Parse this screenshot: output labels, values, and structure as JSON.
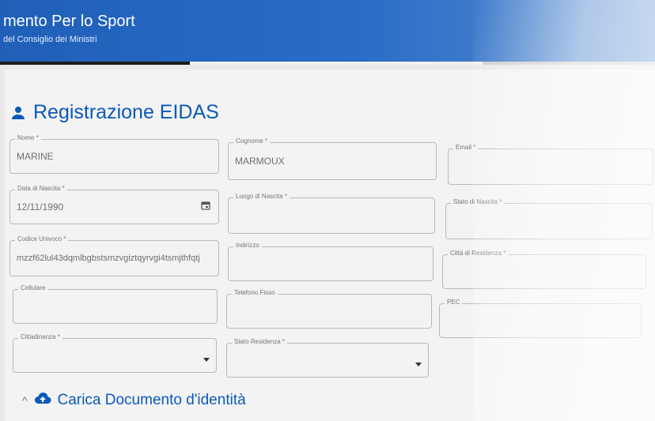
{
  "header": {
    "title": "mento Per lo Sport",
    "subtitle": "del Consiglio dei Ministri"
  },
  "page_title": "Registrazione EIDAS",
  "fields": {
    "nome": {
      "label": "Nome *",
      "value": "MARINE"
    },
    "cognome": {
      "label": "Cognome *",
      "value": "MARMOUX"
    },
    "email": {
      "label": "Email *",
      "value": ""
    },
    "data_nascita": {
      "label": "Data di Nascita *",
      "value": "12/11/1990"
    },
    "luogo_nascita": {
      "label": "Luogo di Nascita *",
      "value": ""
    },
    "stato_nascita": {
      "label": "Stato di Nascita *",
      "value": ""
    },
    "codice_univoco": {
      "label": "Codice Univoco *",
      "value": "mzzf62lul43dqmlbgbstsmzvgiztqyrvgi4tsmjthfqtj"
    },
    "indirizzo": {
      "label": "Indirizzo",
      "value": ""
    },
    "citta_residenza": {
      "label": "Città di Residenza *",
      "value": ""
    },
    "cellulare": {
      "label": "Cellulare",
      "value": ""
    },
    "telefono_fisso": {
      "label": "Telefono Fisso",
      "value": ""
    },
    "pec": {
      "label": "PEC",
      "value": ""
    },
    "cittadinanza": {
      "label": "Cittadinanza *",
      "value": ""
    },
    "stato_residenza": {
      "label": "Stato Residenza *",
      "value": ""
    }
  },
  "section": {
    "title": "Carica Documento d'identità"
  },
  "colors": {
    "brand_blue": "#0a59b7",
    "header_blue": "#1f5fb8"
  }
}
